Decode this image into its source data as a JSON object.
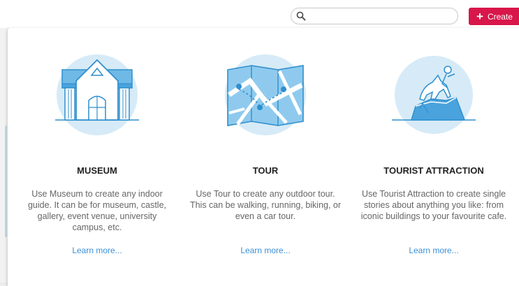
{
  "header": {
    "search": {
      "placeholder": "",
      "value": ""
    },
    "create_label": "Create"
  },
  "cards": [
    {
      "title": "MUSEUM",
      "description": "Use Museum to create any indoor guide. It can be for museum, castle, gallery, event venue, university campus, etc.",
      "link": "Learn more...",
      "icon": "museum-icon"
    },
    {
      "title": "TOUR",
      "description": "Use Tour to create any outdoor tour. This can be walking, running, biking, or even a car tour.",
      "link": "Learn more...",
      "icon": "map-icon"
    },
    {
      "title": "TOURIST ATTRACTION",
      "description": "Use Tourist Attraction to create single stories about anything you like: from iconic buildings to your favourite cafe.",
      "link": "Learn more...",
      "icon": "statue-icon"
    }
  ],
  "colors": {
    "accent": "#d8164a",
    "link": "#3a8fd6",
    "illustration_bg": "#d6ebf7",
    "illustration_stroke": "#2f8fce"
  }
}
